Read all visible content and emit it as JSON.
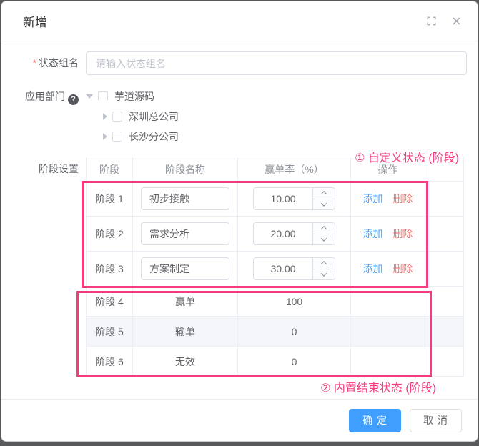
{
  "dialog": {
    "title": "新增",
    "footer": {
      "confirm_label": "确 定",
      "cancel_label": "取 消"
    }
  },
  "form": {
    "group_name": {
      "required_mark": "*",
      "label": "状态组名",
      "value": "",
      "placeholder": "请输入状态组名"
    },
    "department": {
      "label": "应用部门",
      "help_mark": "?",
      "tree": [
        {
          "label": "芋道源码",
          "expanded": true,
          "checked": false
        },
        {
          "label": "深圳总公司",
          "expanded": false,
          "checked": false
        },
        {
          "label": "长沙分公司",
          "expanded": false,
          "checked": false
        }
      ]
    },
    "stages": {
      "label": "阶段设置",
      "columns": [
        "阶段",
        "阶段名称",
        "赢单率（%）",
        "操作"
      ],
      "actions": {
        "add": "添加",
        "remove": "删除"
      },
      "rows": [
        {
          "stage": "阶段 1",
          "name": "初步接触",
          "rate": "10.00",
          "editable": true
        },
        {
          "stage": "阶段 2",
          "name": "需求分析",
          "rate": "20.00",
          "editable": true
        },
        {
          "stage": "阶段 3",
          "name": "方案制定",
          "rate": "30.00",
          "editable": true
        },
        {
          "stage": "阶段 4",
          "name": "赢单",
          "rate": "100",
          "editable": false
        },
        {
          "stage": "阶段 5",
          "name": "输单",
          "rate": "0",
          "editable": false
        },
        {
          "stage": "阶段 6",
          "name": "无效",
          "rate": "0",
          "editable": false
        }
      ]
    }
  },
  "annotations": {
    "custom_states": "① 自定义状态 (阶段)",
    "builtin_states": "② 内置结束状态 (阶段)"
  },
  "colors": {
    "primary_blue": "#409eff",
    "danger_red": "#f56c6c",
    "annotation_pink": "#f43b7f"
  }
}
